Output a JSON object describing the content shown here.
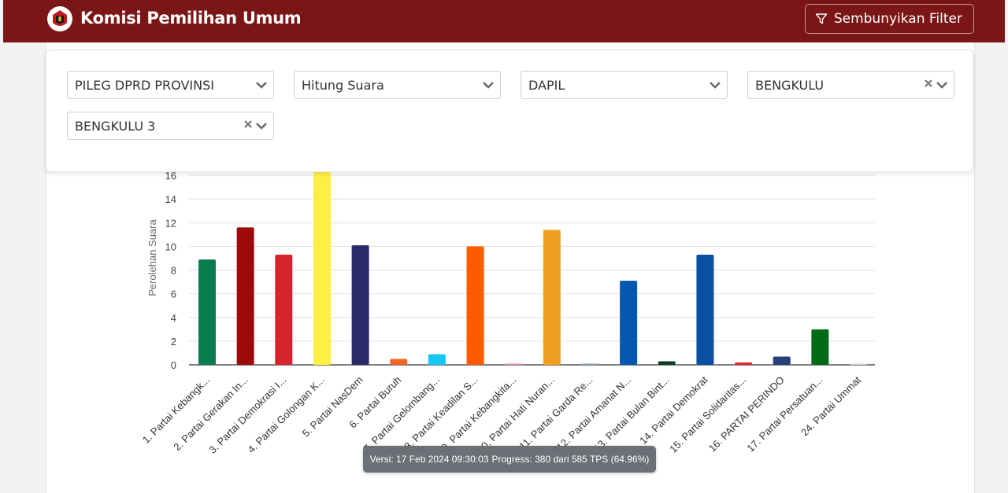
{
  "header": {
    "title": "Komisi Pemilihan Umum",
    "filter_button_label": "Sembunyikan Filter",
    "bg_color": "#7b1616"
  },
  "filters": {
    "election": "PILEG DPRD PROVINSI",
    "mode": "Hitung Suara",
    "level": "DAPIL",
    "province": "BENGKULU",
    "district": "BENGKULU 3"
  },
  "status": {
    "version": "Versi: 17 Feb 2024 09:30:03",
    "progress": "Progress: 380 dari 585 TPS (64.96%)"
  },
  "chart_data": {
    "type": "bar",
    "ylabel": "Perolehan Suara",
    "ylim": [
      0,
      16
    ],
    "yticks": [
      0,
      2,
      4,
      6,
      8,
      10,
      12,
      14,
      16
    ],
    "grid": true,
    "categories": [
      "1. Partai Kebangk...",
      "2. Partai Gerakan In...",
      "3. Partai Demokrasi I...",
      "4. Partai Golongan K...",
      "5. Partai NasDem",
      "6. Partai Buruh",
      "7. Partai Gelombang...",
      "8. Partai Keadilan S...",
      "9. Partai Kebangkita...",
      "10. Partai Hati Nuran...",
      "11. Partai Garda Re...",
      "12. Partai Amanat N...",
      "13. Partai Bulan Bint...",
      "14. Partai Demokrat",
      "15. Partai Solidaritas...",
      "16. PARTAI PERINDO",
      "17. Partai Persatuan...",
      "24. Partai Ummat"
    ],
    "values": [
      8.9,
      11.6,
      9.3,
      16.3,
      10.1,
      0.5,
      0.9,
      10.0,
      0.1,
      11.4,
      0.1,
      7.1,
      0.3,
      9.3,
      0.2,
      0.7,
      3.0,
      0.05
    ],
    "colors": [
      "#0a7d4f",
      "#9e0a0a",
      "#d8232e",
      "#ffee44",
      "#2a2a6b",
      "#f26522",
      "#14c7f5",
      "#ff5a00",
      "#f28aa0",
      "#f0a020",
      "#8a9aa6",
      "#0657b0",
      "#0c3d22",
      "#0a4fa0",
      "#e0252e",
      "#27407a",
      "#006b16",
      "#d0d0d0"
    ]
  }
}
